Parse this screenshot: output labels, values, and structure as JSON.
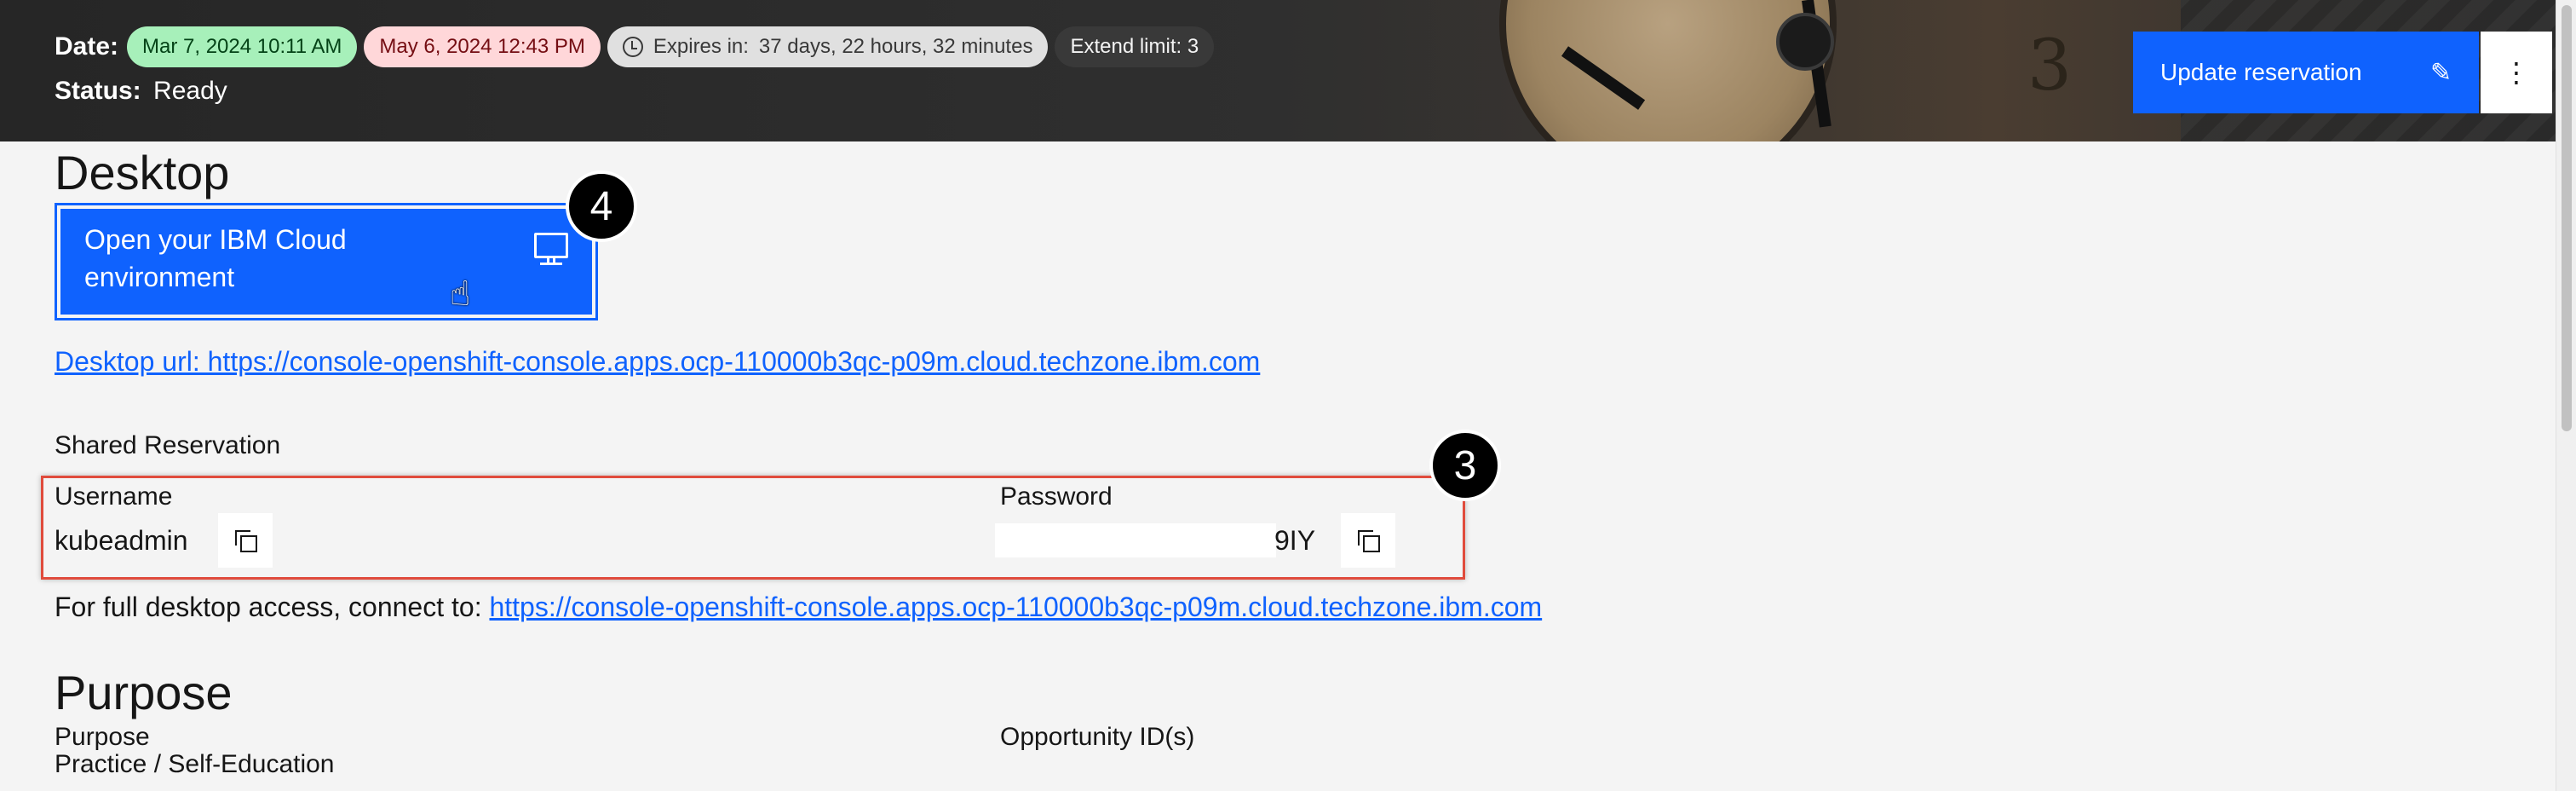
{
  "header": {
    "date_label": "Date:",
    "start_date": "Mar 7, 2024 10:11 AM",
    "end_date": "May 6, 2024 12:43 PM",
    "expires_prefix": "Expires in:",
    "expires_value": "37 days, 22 hours, 32 minutes",
    "extend_limit": "Extend limit: 3",
    "status_label": "Status:",
    "status_value": "Ready",
    "update_button": "Update reservation",
    "overflow_glyph": "⋮",
    "edit_glyph": "✎",
    "colors": {
      "start_tag": "#a7f0ba",
      "end_tag": "#ffd7d9",
      "primary": "#0f62fe"
    }
  },
  "desktop": {
    "heading": "Desktop",
    "open_button": "Open your IBM Cloud environment",
    "url_text": "Desktop url: https://console-openshift-console.apps.ocp-110000b3qc-p09m.cloud.techzone.ibm.com",
    "icon": "monitor-icon"
  },
  "annotations": {
    "badge_desktop": "4",
    "badge_credentials": "3"
  },
  "shared": {
    "label": "Shared Reservation",
    "username_label": "Username",
    "username_value": "kubeadmin",
    "password_label": "Password",
    "password_visible_tail": "9IY",
    "full_access_prefix": "For full desktop access, connect to: ",
    "full_access_url": "https://console-openshift-console.apps.ocp-110000b3qc-p09m.cloud.techzone.ibm.com"
  },
  "purpose": {
    "heading": "Purpose",
    "purpose_label": "Purpose",
    "purpose_value": "Practice / Self-Education",
    "opportunity_label": "Opportunity ID(s)"
  }
}
